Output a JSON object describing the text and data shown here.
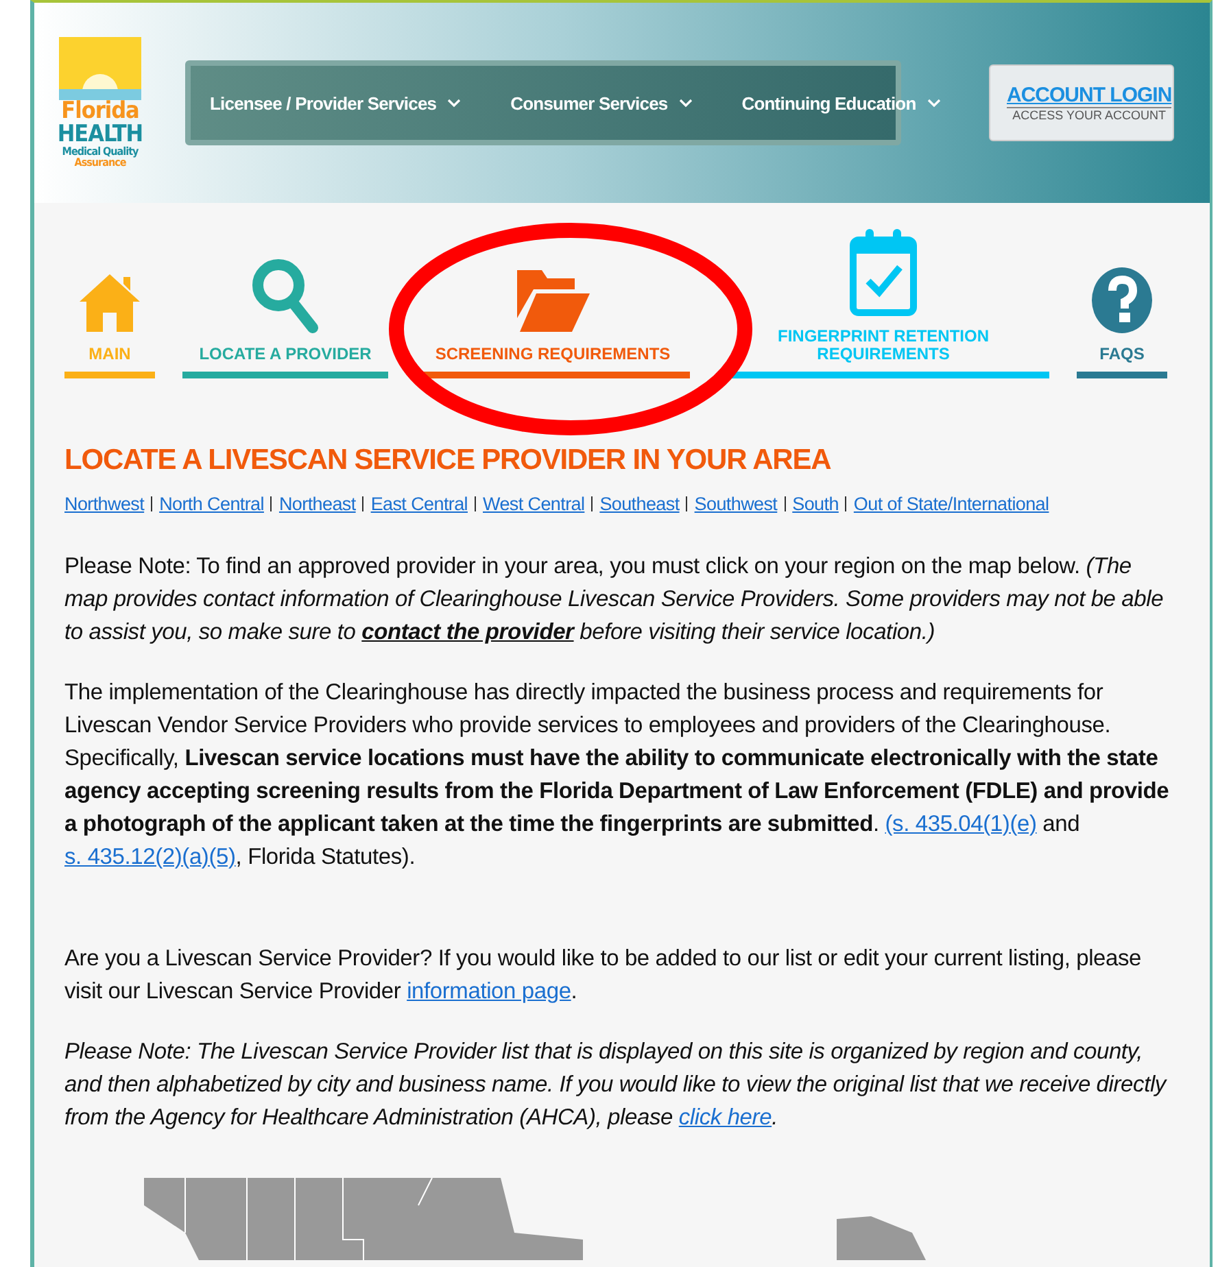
{
  "logo": {
    "word_1": "Florida",
    "word_2": "HEALTH",
    "tagline_1": "Medical Quality",
    "tagline_2": "Assurance"
  },
  "nav": [
    {
      "label": "Licensee / Provider Services"
    },
    {
      "label": "Consumer Services"
    },
    {
      "label": "Continuing Education"
    }
  ],
  "account": {
    "title": "ACCOUNT LOGIN",
    "subtitle": "ACCESS YOUR ACCOUNT"
  },
  "tabs": [
    {
      "label": "MAIN",
      "kind": "home",
      "color": "#fbb017"
    },
    {
      "label": "LOCATE A PROVIDER",
      "kind": "search",
      "color": "#26ab9f"
    },
    {
      "label": "SCREENING REQUIREMENTS",
      "kind": "folder",
      "color": "#f15a0c"
    },
    {
      "label": "FINGERPRINT RETENTION REQUIREMENTS",
      "kind": "calendar",
      "color": "#00c6f3"
    },
    {
      "label": "FAQS",
      "kind": "question",
      "color": "#2b7a92"
    }
  ],
  "heading": "LOCATE A LIVESCAN SERVICE PROVIDER IN YOUR AREA",
  "regions": [
    "Northwest",
    "North Central",
    "Northeast",
    "East Central",
    "West Central",
    "Southeast",
    "Southwest",
    "South",
    "Out of State/International"
  ],
  "paragraphs": [
    {
      "italic": false,
      "segments": [
        {
          "kind": "text",
          "text": "Please Note: To find an approved provider in your area, you must click on your region on the map below. *(The map provides contact information of Clearinghouse Livescan Service Providers. Some providers may not be able to assist you, so make sure to* "
        },
        {
          "kind": "strong-link",
          "text": "contact the provider"
        },
        {
          "kind": "text",
          "text": " *before visiting their service location.)*"
        }
      ]
    },
    {
      "italic": false,
      "segments": [
        {
          "kind": "text",
          "text": "The implementation of the Clearinghouse has directly impacted the business process and requirements for Livescan Vendor Service Providers who provide services to employees and providers of the Clearinghouse. Specifically, **Livescan service locations must have the ability to communicate electronically with the state agency accepting screening results from the Florida Department of Law Enforcement (FDLE) and provide a photograph of the applicant taken at the time the fingerprints are submitted**. "
        },
        {
          "kind": "link",
          "text": "(s. 435.04(1)(e)"
        },
        {
          "kind": "text",
          "text": " and "
        },
        {
          "kind": "link",
          "text": "s. 435.12(2)(a)(5)"
        },
        {
          "kind": "text",
          "text": ", Florida Statutes)."
        }
      ]
    },
    {
      "italic": false,
      "segments": [
        {
          "kind": "text",
          "text": "Are you a Livescan Service Provider? If you would like to be added to our list or edit your current listing, please visit our Livescan Service Provider "
        },
        {
          "kind": "link",
          "text": "information page"
        },
        {
          "kind": "text",
          "text": "."
        }
      ]
    },
    {
      "italic": true,
      "segments": [
        {
          "kind": "text",
          "text": "Please Note: The Livescan Service Provider list that is displayed on this site is organized by region and county, and then alphabetized by city and business name. If you would like to view the original list that we receive directly from the Agency for Healthcare Administration (AHCA), please "
        },
        {
          "kind": "link",
          "text": "click here"
        },
        {
          "kind": "text",
          "text": "."
        }
      ]
    }
  ]
}
